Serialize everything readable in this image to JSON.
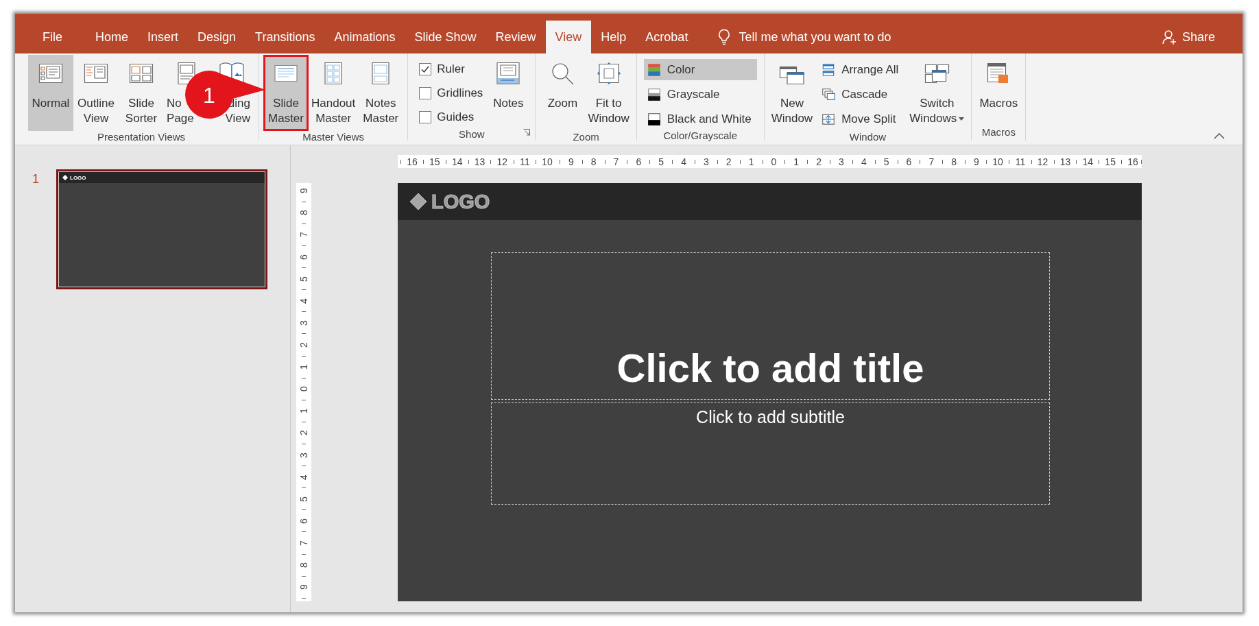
{
  "tabs": [
    {
      "label": "File",
      "selected": false
    },
    {
      "label": "Home",
      "selected": false
    },
    {
      "label": "Insert",
      "selected": false
    },
    {
      "label": "Design",
      "selected": false
    },
    {
      "label": "Transitions",
      "selected": false
    },
    {
      "label": "Animations",
      "selected": false
    },
    {
      "label": "Slide Show",
      "selected": false
    },
    {
      "label": "Review",
      "selected": false
    },
    {
      "label": "View",
      "selected": true
    },
    {
      "label": "Help",
      "selected": false
    },
    {
      "label": "Acrobat",
      "selected": false
    }
  ],
  "tell_me": {
    "placeholder": "Tell me what you want to do"
  },
  "share": "Share",
  "ribbon": {
    "groups": [
      {
        "label": "Presentation Views",
        "items": [
          {
            "kind": "large",
            "lines": [
              "Normal"
            ],
            "selected": true
          },
          {
            "kind": "large",
            "lines": [
              "Outline",
              "View"
            ],
            "selected": false
          },
          {
            "kind": "large",
            "lines": [
              "Slide",
              "Sorter"
            ],
            "selected": false
          },
          {
            "kind": "large",
            "lines": [
              "No",
              "Page"
            ],
            "selected": false
          },
          {
            "kind": "large",
            "lines": [
              "ding",
              "View"
            ],
            "selected": false
          }
        ]
      },
      {
        "label": "Master Views",
        "items": [
          {
            "kind": "large",
            "lines": [
              "Slide",
              "Master"
            ],
            "selected": true,
            "outlined": true
          },
          {
            "kind": "large",
            "lines": [
              "Handout",
              "Master"
            ],
            "selected": false,
            "outlined": false
          },
          {
            "kind": "large",
            "lines": [
              "Notes",
              "Master"
            ],
            "selected": false,
            "outlined": false
          }
        ]
      },
      {
        "label": "Show",
        "launcher": true,
        "items": [
          {
            "kind": "check",
            "label": "Ruler",
            "checked": true
          },
          {
            "kind": "check",
            "label": "Gridlines",
            "checked": false
          },
          {
            "kind": "check",
            "label": "Guides",
            "checked": false
          },
          {
            "kind": "large",
            "lines": [
              "Notes"
            ]
          }
        ]
      },
      {
        "label": "Zoom",
        "items": [
          {
            "kind": "large",
            "lines": [
              "Zoom"
            ]
          },
          {
            "kind": "large",
            "lines": [
              "Fit to",
              "Window"
            ]
          }
        ]
      },
      {
        "label": "Color/Grayscale",
        "items": [
          {
            "kind": "small",
            "label": "Color",
            "selected": true
          },
          {
            "kind": "small",
            "label": "Grayscale",
            "selected": false
          },
          {
            "kind": "small",
            "label": "Black and White",
            "selected": false
          }
        ]
      },
      {
        "label": "Window",
        "items": [
          {
            "kind": "large",
            "lines": [
              "New",
              "Window"
            ]
          },
          {
            "kind": "small",
            "label": "Arrange All"
          },
          {
            "kind": "small",
            "label": "Cascade"
          },
          {
            "kind": "small",
            "label": "Move Split"
          },
          {
            "kind": "large",
            "lines": [
              "Switch",
              "Windows"
            ],
            "dropdown": true
          }
        ]
      },
      {
        "label": "Macros",
        "items": [
          {
            "kind": "large",
            "lines": [
              "Macros"
            ]
          }
        ]
      }
    ]
  },
  "callout": {
    "label": "1"
  },
  "thumbnails": [
    {
      "number": "1",
      "selected": true,
      "logo": "LOGO"
    }
  ],
  "ruler_horizontal": [
    "16",
    "15",
    "14",
    "13",
    "12",
    "11",
    "10",
    "9",
    "8",
    "7",
    "6",
    "5",
    "4",
    "3",
    "2",
    "1",
    "0",
    "1",
    "2",
    "3",
    "4",
    "5",
    "6",
    "7",
    "8",
    "9",
    "10",
    "11",
    "12",
    "13",
    "14",
    "15",
    "16"
  ],
  "ruler_vertical": [
    "9",
    "8",
    "7",
    "6",
    "5",
    "4",
    "3",
    "2",
    "1",
    "0",
    "1",
    "2",
    "3",
    "4",
    "5",
    "6",
    "7",
    "8",
    "9"
  ],
  "slide": {
    "logo": "LOGO",
    "title_placeholder": "Click to add title",
    "subtitle_placeholder": "Click to add subtitle"
  }
}
